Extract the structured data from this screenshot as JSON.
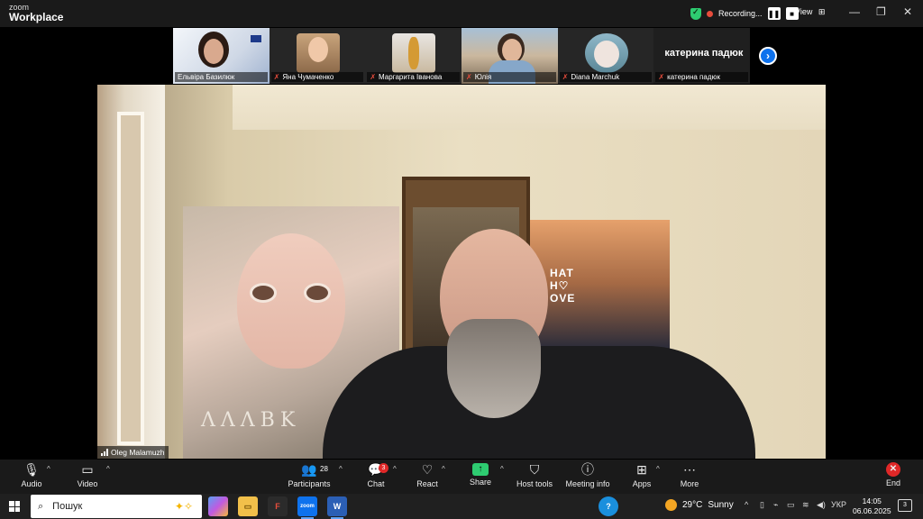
{
  "app": {
    "logo_line1": "zoom",
    "logo_line2": "Workplace"
  },
  "header": {
    "recording_label": "Recording...",
    "pause_icon": "pause-icon",
    "stop_icon": "stop-icon",
    "view_label": "View",
    "window_controls": [
      "—",
      "❐",
      "✕"
    ]
  },
  "gallery": {
    "participants": [
      {
        "name": "Ельвіра Базилюк",
        "muted": false
      },
      {
        "name": "Яна Чумаченко",
        "muted": true
      },
      {
        "name": "Маргарита Іванова",
        "muted": true
      },
      {
        "name": "Юлія",
        "muted": true
      },
      {
        "name": "Diana Marchuk",
        "muted": true
      },
      {
        "name": "катерина падюк",
        "muted": true,
        "big_name": "катерина падюк"
      }
    ],
    "next_icon": "chevron-right-icon"
  },
  "main_video": {
    "speaker_name": "Oleg Malamuzh",
    "poster_text": "ΛΛΛΒΚ",
    "poster2_text_line1": "HAT",
    "poster2_text_line2": "H♡",
    "poster2_text_line3": "OVE"
  },
  "toolbar": {
    "audio": "Audio",
    "video": "Video",
    "participants": "Participants",
    "participants_count": "28",
    "chat": "Chat",
    "chat_badge": "3",
    "react": "React",
    "share": "Share",
    "host_tools": "Host tools",
    "meeting_info": "Meeting info",
    "apps": "Apps",
    "more": "More",
    "end": "End"
  },
  "taskbar": {
    "search_placeholder": "Пошук",
    "weather_temp": "29°C",
    "weather_desc": "Sunny",
    "lang": "УКР",
    "time": "14:05",
    "date": "06.06.2025",
    "notifications": "3"
  },
  "colors": {
    "accent": "#0e72ed",
    "recording": "#e74c3c",
    "share_green": "#2ecc71",
    "end_red": "#e02828"
  }
}
